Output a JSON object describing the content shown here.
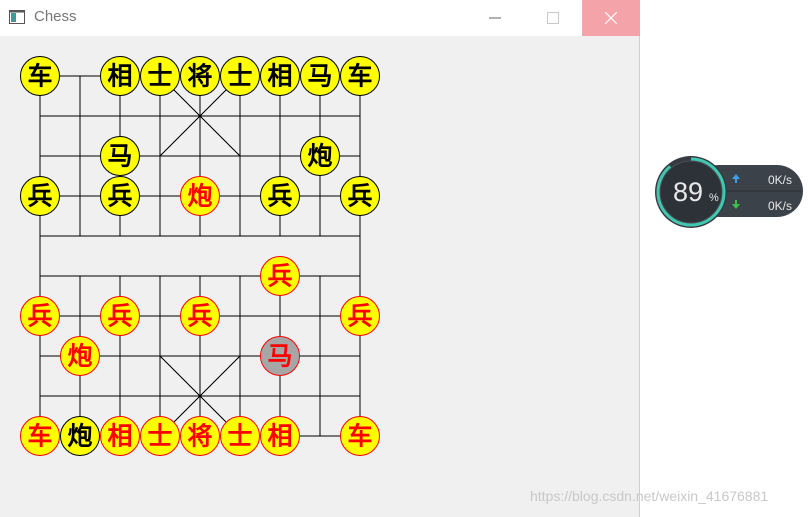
{
  "window": {
    "title": "Chess",
    "controls": {
      "minimize": "minimize",
      "maximize": "maximize",
      "close": "close"
    }
  },
  "board": {
    "line_color": "#000000",
    "piece_fill": "#ffff00",
    "selected_fill": "#a6a6a6",
    "black_side_color": "#000000",
    "red_side_color": "#ff0000",
    "pieces": [
      {
        "char": "车",
        "side": "black",
        "col": 0,
        "row": 0,
        "name": "piece-black-chariot-left"
      },
      {
        "char": "相",
        "side": "black",
        "col": 2,
        "row": 0,
        "name": "piece-black-elephant-left"
      },
      {
        "char": "士",
        "side": "black",
        "col": 3,
        "row": 0,
        "name": "piece-black-advisor-left"
      },
      {
        "char": "将",
        "side": "black",
        "col": 4,
        "row": 0,
        "name": "piece-black-general"
      },
      {
        "char": "士",
        "side": "black",
        "col": 5,
        "row": 0,
        "name": "piece-black-advisor-right"
      },
      {
        "char": "相",
        "side": "black",
        "col": 6,
        "row": 0,
        "name": "piece-black-elephant-right"
      },
      {
        "char": "马",
        "side": "black",
        "col": 7,
        "row": 0,
        "name": "piece-black-horse-right"
      },
      {
        "char": "车",
        "side": "black",
        "col": 8,
        "row": 0,
        "name": "piece-black-chariot-right"
      },
      {
        "char": "马",
        "side": "black",
        "col": 2,
        "row": 2,
        "name": "piece-black-horse-left"
      },
      {
        "char": "炮",
        "side": "black",
        "col": 7,
        "row": 2,
        "name": "piece-black-cannon-right"
      },
      {
        "char": "兵",
        "side": "black",
        "col": 0,
        "row": 3,
        "name": "piece-black-soldier-1"
      },
      {
        "char": "兵",
        "side": "black",
        "col": 2,
        "row": 3,
        "name": "piece-black-soldier-2"
      },
      {
        "char": "兵",
        "side": "black",
        "col": 6,
        "row": 3,
        "name": "piece-black-soldier-4"
      },
      {
        "char": "兵",
        "side": "black",
        "col": 8,
        "row": 3,
        "name": "piece-black-soldier-5"
      },
      {
        "char": "炮",
        "side": "red",
        "col": 4,
        "row": 3,
        "name": "piece-red-cannon-advanced"
      },
      {
        "char": "兵",
        "side": "red",
        "col": 6,
        "row": 5,
        "name": "piece-red-soldier-advanced"
      },
      {
        "char": "兵",
        "side": "red",
        "col": 0,
        "row": 6,
        "name": "piece-red-soldier-1"
      },
      {
        "char": "兵",
        "side": "red",
        "col": 2,
        "row": 6,
        "name": "piece-red-soldier-2"
      },
      {
        "char": "兵",
        "side": "red",
        "col": 4,
        "row": 6,
        "name": "piece-red-soldier-3"
      },
      {
        "char": "兵",
        "side": "red",
        "col": 8,
        "row": 6,
        "name": "piece-red-soldier-5"
      },
      {
        "char": "炮",
        "side": "red",
        "col": 1,
        "row": 7,
        "name": "piece-red-cannon"
      },
      {
        "char": "马",
        "side": "red",
        "col": 6,
        "row": 7,
        "name": "piece-red-horse-selected",
        "selected": true
      },
      {
        "char": "车",
        "side": "red",
        "col": 0,
        "row": 9,
        "name": "piece-red-chariot-left"
      },
      {
        "char": "炮",
        "side": "black",
        "col": 1,
        "row": 9,
        "name": "piece-black-cannon-captured-square"
      },
      {
        "char": "相",
        "side": "red",
        "col": 2,
        "row": 9,
        "name": "piece-red-elephant-left"
      },
      {
        "char": "士",
        "side": "red",
        "col": 3,
        "row": 9,
        "name": "piece-red-advisor-left"
      },
      {
        "char": "将",
        "side": "red",
        "col": 4,
        "row": 9,
        "name": "piece-red-general"
      },
      {
        "char": "士",
        "side": "red",
        "col": 5,
        "row": 9,
        "name": "piece-red-advisor-right"
      },
      {
        "char": "相",
        "side": "red",
        "col": 6,
        "row": 9,
        "name": "piece-red-elephant-right"
      },
      {
        "char": "车",
        "side": "red",
        "col": 8,
        "row": 9,
        "name": "piece-red-chariot-right"
      }
    ]
  },
  "net_monitor": {
    "cpu_value": "89",
    "cpu_unit": "%",
    "cpu_fraction": 0.89,
    "upload": "0K/s",
    "download": "0K/s",
    "up_arrow_color": "#3aa0e8",
    "down_arrow_color": "#3bbf4a"
  },
  "watermark": "https://blog.csdn.net/weixin_41676881"
}
